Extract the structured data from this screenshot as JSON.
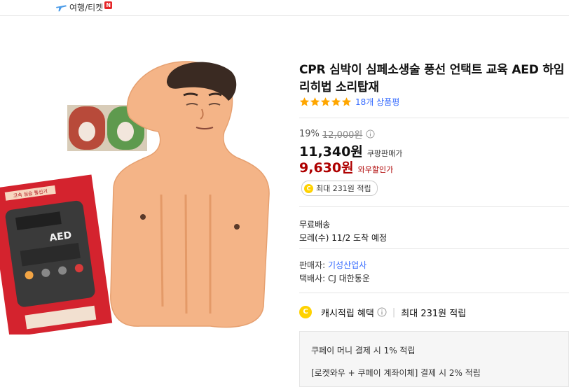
{
  "nav": {
    "travel_label": "여행/티켓",
    "new_badge": "N",
    "travel_icon": "airplane-icon"
  },
  "product": {
    "title": "CPR 심박이 심페소생술 풍선 언택트 교육 AED 하임리히법 소리탑재",
    "rating": 5,
    "review_count_label": "18개 상품평",
    "discount_rate": "19%",
    "original_price": "12,000원",
    "price": "11,340원",
    "price_label": "쿠팡판매가",
    "wow_price": "9,630원",
    "wow_label": "와우할인가",
    "reward_chip": "최대 231원 적립",
    "shipping_title": "무료배송",
    "shipping_eta": "모레(수) 11/2 도착 예정",
    "seller_label": "판매자: ",
    "seller_name": "기성산업사",
    "carrier": "택배사: CJ 대한통운",
    "cash_label": "캐시적립 혜택",
    "cash_max": "최대 231원 적립",
    "coupay_line1": "쿠페이 머니 결제 시 1% 적립",
    "coupay_line2": "[로켓와우 + 쿠페이 계좌이체] 결제 시 2% 적립"
  },
  "image_box": {
    "box_header": "고속 실습 통신기",
    "box_brand": "AED",
    "icon": "cpr-manikin-image"
  },
  "colors": {
    "accent_blue": "#346aff",
    "wow_red": "#ae0000",
    "star": "#ffa600",
    "coin": "#ffd200"
  }
}
